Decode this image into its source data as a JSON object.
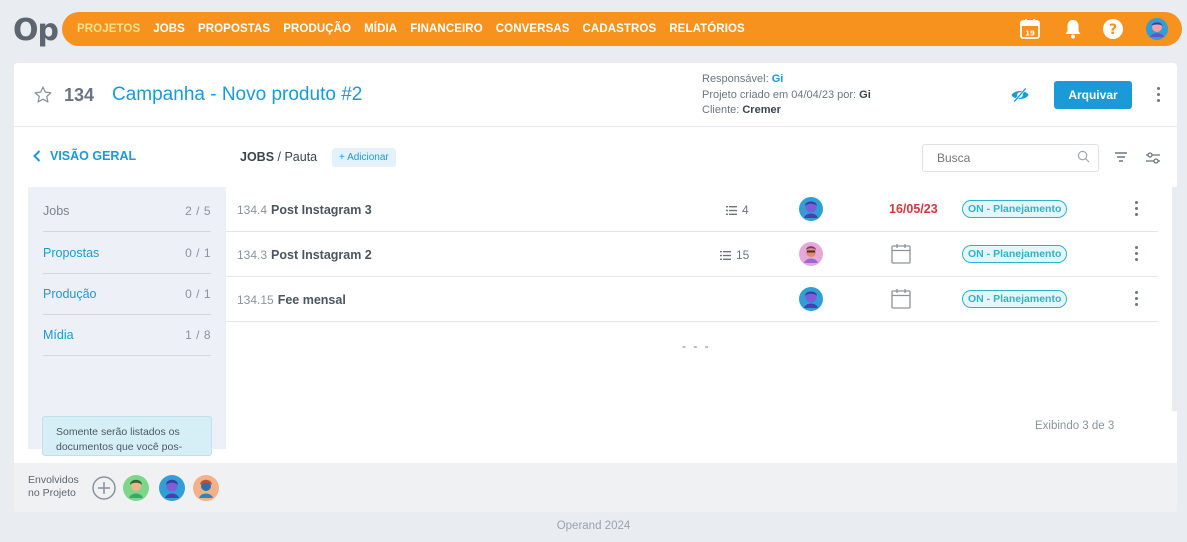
{
  "logo": "Op",
  "nav": {
    "items": [
      "PROJETOS",
      "JOBS",
      "PROPOSTAS",
      "PRODUÇÃO",
      "MÍDIA",
      "FINANCEIRO",
      "CONVERSAS",
      "CADASTROS",
      "RELATÓRIOS"
    ],
    "calendar_day": "19",
    "icons": [
      "calendar-icon",
      "bell-icon",
      "help-icon",
      "user-avatar"
    ]
  },
  "project": {
    "number": "134",
    "title": "Campanha - Novo produto #2",
    "responsavel_label": "Responsável:",
    "responsavel": "Gi",
    "criado_label": "Projeto criado em 04/04/23 por:",
    "criado_por": "Gi",
    "cliente_label": "Cliente:",
    "cliente": "Cremer",
    "archive_label": "Arquivar"
  },
  "toolbar": {
    "back_label": "VISÃO GERAL",
    "crumb_main": "JOBS",
    "crumb_sep": " / ",
    "crumb_sub": "Pauta",
    "add_label": "+ Adicionar",
    "search_placeholder": "Busca"
  },
  "sidebar": {
    "items": [
      {
        "label": "Jobs",
        "count": "2 / 5"
      },
      {
        "label": "Propostas",
        "count": "0 / 1"
      },
      {
        "label": "Produção",
        "count": "0 / 1"
      },
      {
        "label": "Mídia",
        "count": "1 / 8"
      }
    ],
    "note": "Somente serão listados os documentos que você pos-"
  },
  "jobs": [
    {
      "code": "134.4",
      "name": "Post Instagram 3",
      "tasks": "4",
      "date": "16/05/23",
      "status": "ON - Planejamento"
    },
    {
      "code": "134.3",
      "name": "Post Instagram 2",
      "tasks": "15",
      "date": "",
      "status": "ON - Planejamento"
    },
    {
      "code": "134.15",
      "name": "Fee mensal",
      "tasks": "",
      "date": "",
      "status": "ON - Planejamento"
    }
  ],
  "list_more": "- - -",
  "showing": "Exibindo 3 de 3",
  "involved": {
    "label_line1": "Envolvidos",
    "label_line2": "no Projeto"
  },
  "copyright": "Operand 2024",
  "colors": {
    "nav": "#f7921e",
    "accent": "#1a9ad7",
    "date_overdue": "#d8343f",
    "status": "#2fb3c8"
  }
}
